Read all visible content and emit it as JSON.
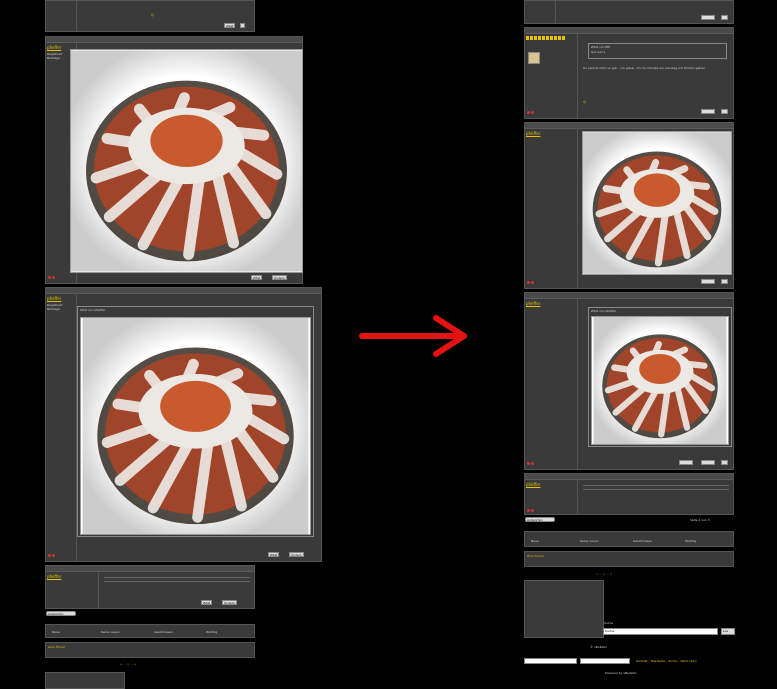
{
  "arrow": {
    "color": "#e41212"
  },
  "cake": {
    "colors": {
      "dough": "#a0442a",
      "sugar": "#ece8e4",
      "hole": "#c85a2e"
    }
  },
  "left": {
    "quote_title": "Zitat von pfeiffer",
    "post_user": "pfeiffer",
    "actions": {
      "quote": "Zitat",
      "edit": "Ändern"
    },
    "reply_button": "Antworten",
    "legend_items": [
      "Neue",
      "Keine neuen",
      "Geschlossen",
      "Wichtig"
    ],
    "jump_label": "Zum Forum"
  },
  "right": {
    "quote_title_1": "Zitat von Elfi",
    "quote_text_1": "Gut war's",
    "body_text": "Du kennst mich so gut... ich glaub, ich mu Oxcake am sonntag auf Omami gehen",
    "quote_title_2": "Zitat von pfeiffer",
    "post_user": "pfeiffer",
    "reply_button": "Antworten",
    "pagination": "Seite 1 von 3",
    "legend_items": [
      "Neue",
      "Keine neuen",
      "Geschlossen",
      "Wichtig"
    ],
    "search_value": "Suche",
    "search_button": "Los",
    "footer_text": "Powered by vBulletin",
    "nav_links": [
      "Kontakt",
      "Startseite",
      "Archiv",
      "Nach oben"
    ],
    "jump_label": "Zum Forum"
  }
}
